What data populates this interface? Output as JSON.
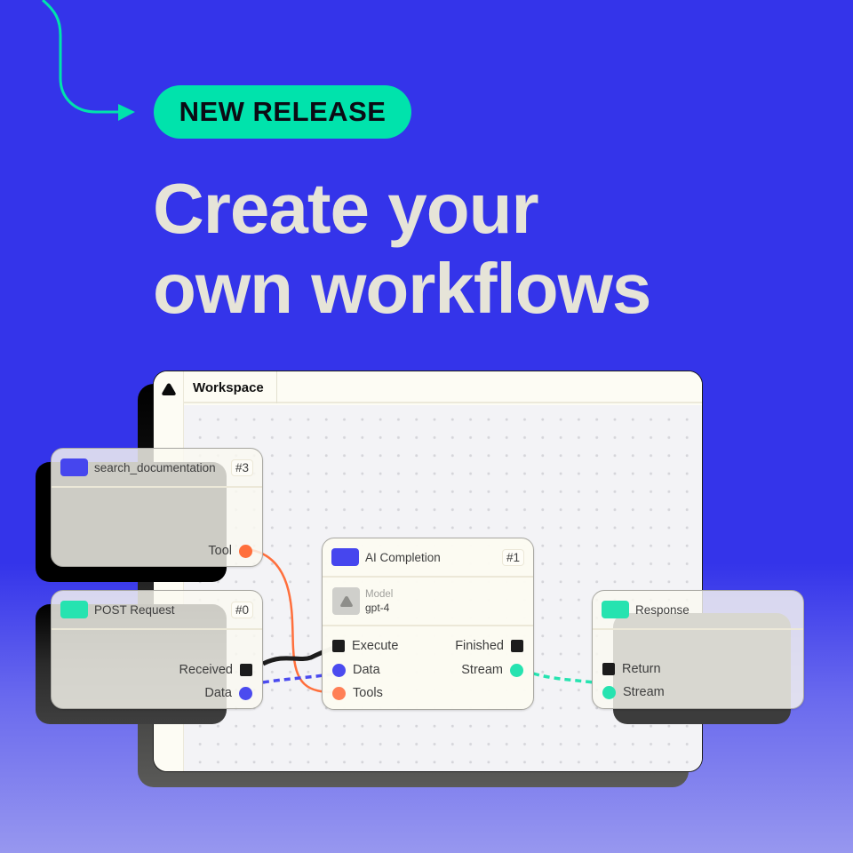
{
  "badge": {
    "label": "NEW RELEASE"
  },
  "headline": {
    "line1": "Create your",
    "line2": "own workflows"
  },
  "colors": {
    "background": "#3434EA",
    "accent_green": "#00E3AC",
    "port_blue": "#4B4BEF",
    "port_orange": "#FF6F3C",
    "port_teal": "#26E3B0",
    "headline": "#E6E4D8"
  },
  "window": {
    "logo_icon": "triangle-logo-icon",
    "tabs": [
      {
        "label": "Workspace",
        "active": true
      }
    ]
  },
  "nodes": {
    "search_documentation": {
      "title": "search_documentation",
      "number": "#3",
      "outputs": [
        {
          "label": "Tool",
          "shape": "circle",
          "color": "orange"
        }
      ]
    },
    "post_request": {
      "title": "POST Request",
      "number": "#0",
      "outputs": [
        {
          "label": "Received",
          "shape": "square",
          "color": "black"
        },
        {
          "label": "Data",
          "shape": "circle",
          "color": "blue"
        }
      ]
    },
    "ai_completion": {
      "title": "AI Completion",
      "number": "#1",
      "model_label": "Model",
      "model_value": "gpt-4",
      "inputs": [
        {
          "label": "Execute",
          "shape": "square",
          "color": "black"
        },
        {
          "label": "Data",
          "shape": "circle",
          "color": "blue"
        },
        {
          "label": "Tools",
          "shape": "circle",
          "color": "orange"
        }
      ],
      "outputs": [
        {
          "label": "Finished",
          "shape": "square",
          "color": "black"
        },
        {
          "label": "Stream",
          "shape": "circle",
          "color": "teal"
        }
      ]
    },
    "response": {
      "title": "Response",
      "inputs": [
        {
          "label": "Return",
          "shape": "square",
          "color": "black"
        },
        {
          "label": "Stream",
          "shape": "circle",
          "color": "teal"
        }
      ]
    }
  },
  "connections": [
    {
      "from": "search_documentation.Tool",
      "to": "ai_completion.Tools",
      "style": "solid",
      "color": "orange"
    },
    {
      "from": "post_request.Received",
      "to": "ai_completion.Execute",
      "style": "solid",
      "color": "black"
    },
    {
      "from": "post_request.Data",
      "to": "ai_completion.Data",
      "style": "dashed",
      "color": "blue"
    },
    {
      "from": "ai_completion.Stream",
      "to": "response.Stream",
      "style": "dashed",
      "color": "teal"
    }
  ]
}
